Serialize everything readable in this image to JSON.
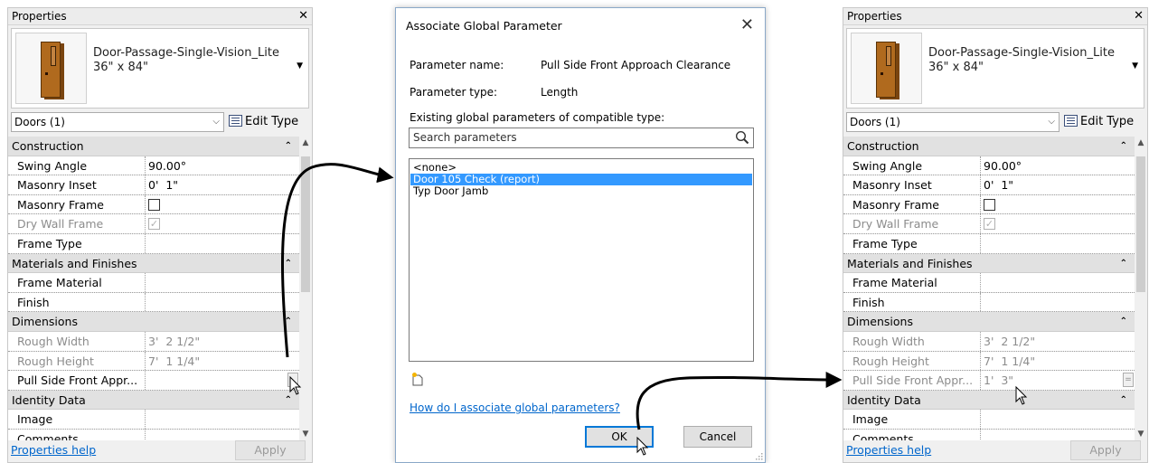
{
  "palette_left": {
    "title": "Properties",
    "close": "✕",
    "type_name_line1": "Door-Passage-Single-Vision_Lite",
    "type_name_line2": "36\" x 84\"",
    "category": "Doors (1)",
    "edit_type": "Edit Type",
    "sections": {
      "construction": "Construction",
      "materials": "Materials and Finishes",
      "dimensions": "Dimensions",
      "identity": "Identity Data"
    },
    "rows": {
      "swing_angle": {
        "label": "Swing Angle",
        "value": "90.00°"
      },
      "masonry_inset": {
        "label": "Masonry Inset",
        "value": "0'  1\""
      },
      "masonry_frame": {
        "label": "Masonry Frame"
      },
      "dry_wall_frame": {
        "label": "Dry Wall Frame"
      },
      "frame_type": {
        "label": "Frame Type",
        "value": ""
      },
      "frame_material": {
        "label": "Frame Material",
        "value": ""
      },
      "finish": {
        "label": "Finish",
        "value": ""
      },
      "rough_width": {
        "label": "Rough Width",
        "value": "3'  2 1/2\""
      },
      "rough_height": {
        "label": "Rough Height",
        "value": "7'  1 1/4\""
      },
      "pull_side": {
        "label": "Pull Side Front Appr...",
        "value": ""
      },
      "image": {
        "label": "Image",
        "value": ""
      },
      "comments": {
        "label": "Comments",
        "value": ""
      }
    },
    "help": "Properties help",
    "apply": "Apply"
  },
  "palette_right": {
    "title": "Properties",
    "close": "✕",
    "type_name_line1": "Door-Passage-Single-Vision_Lite",
    "type_name_line2": "36\" x 84\"",
    "category": "Doors (1)",
    "edit_type": "Edit Type",
    "sections": {
      "construction": "Construction",
      "materials": "Materials and Finishes",
      "dimensions": "Dimensions",
      "identity": "Identity Data"
    },
    "rows": {
      "swing_angle": {
        "label": "Swing Angle",
        "value": "90.00°"
      },
      "masonry_inset": {
        "label": "Masonry Inset",
        "value": "0'  1\""
      },
      "masonry_frame": {
        "label": "Masonry Frame"
      },
      "dry_wall_frame": {
        "label": "Dry Wall Frame"
      },
      "frame_type": {
        "label": "Frame Type",
        "value": ""
      },
      "frame_material": {
        "label": "Frame Material",
        "value": ""
      },
      "finish": {
        "label": "Finish",
        "value": ""
      },
      "rough_width": {
        "label": "Rough Width",
        "value": "3'  2 1/2\""
      },
      "rough_height": {
        "label": "Rough Height",
        "value": "7'  1 1/4\""
      },
      "pull_side": {
        "label": "Pull Side Front Appr...",
        "value": "1'  3\""
      },
      "image": {
        "label": "Image",
        "value": ""
      },
      "comments": {
        "label": "Comments",
        "value": ""
      }
    },
    "help": "Properties help",
    "apply": "Apply"
  },
  "dialog": {
    "title": "Associate Global Parameter",
    "close": "✕",
    "param_name_label": "Parameter name:",
    "param_name_value": "Pull Side Front Approach Clearance",
    "param_type_label": "Parameter type:",
    "param_type_value": "Length",
    "existing_label": "Existing global parameters of compatible type:",
    "search_placeholder": "Search parameters",
    "items": [
      "<none>",
      "Door 105 Check (report)",
      "Typ Door Jamb"
    ],
    "selected_index": 1,
    "help_link": "How do I associate global parameters?",
    "ok": "OK",
    "cancel": "Cancel"
  },
  "colors": {
    "selection": "#3399ff",
    "link": "#0066cc",
    "door": "#b06a1e"
  }
}
